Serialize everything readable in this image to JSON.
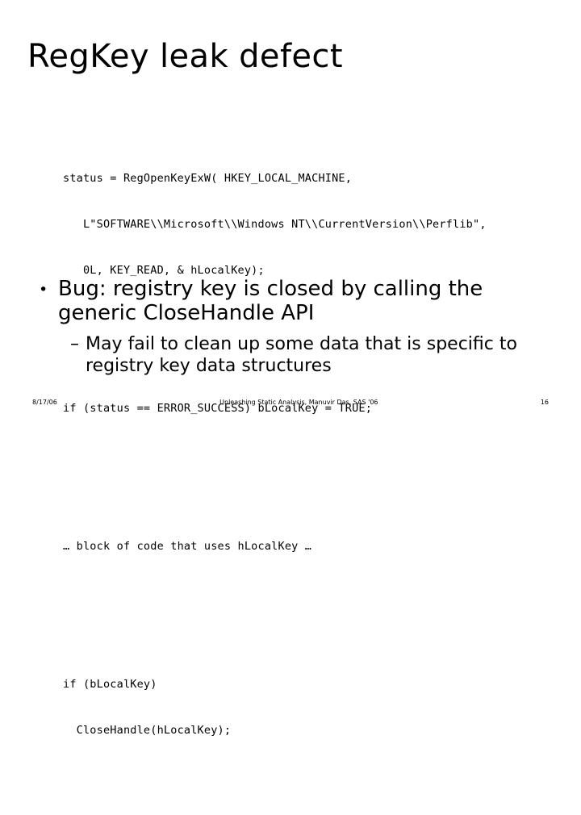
{
  "slide": {
    "title": "RegKey leak defect",
    "code": {
      "paragraphs": [
        {
          "lines": [
            "status = RegOpenKeyExW( HKEY_LOCAL_MACHINE,",
            "   L\"SOFTWARE\\\\Microsoft\\\\Windows NT\\\\CurrentVersion\\\\Perflib\",",
            "   0L, KEY_READ, & hLocalKey);"
          ]
        },
        {
          "lines": [
            "if (status == ERROR_SUCCESS) bLocalKey = TRUE;"
          ]
        },
        {
          "lines": [
            "… block of code that uses hLocalKey …"
          ]
        },
        {
          "lines": [
            "if (bLocalKey)",
            "  CloseHandle(hLocalKey);"
          ]
        }
      ]
    },
    "bullets": [
      {
        "marker": "•",
        "text": "Bug: registry key is closed by calling the generic CloseHandle API",
        "subbullets": [
          {
            "marker": "–",
            "text": "May fail to clean up some data that is specific to registry key data structures"
          }
        ]
      }
    ],
    "footer": {
      "date": "8/17/06",
      "center": "Unleashing Static Analysis, Manuvir Das, SAS '06",
      "page": "16"
    }
  }
}
